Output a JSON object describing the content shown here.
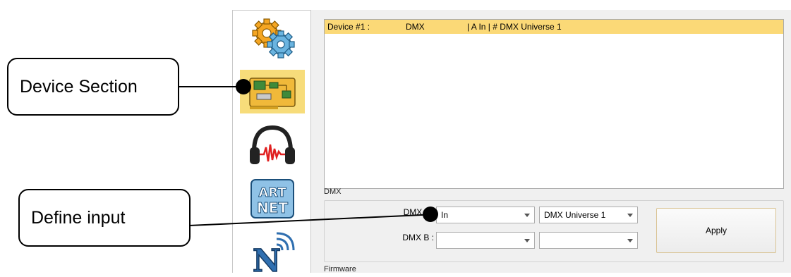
{
  "sidebar": {
    "items": [
      {
        "name": "settings",
        "icon": "gears-icon",
        "active": false
      },
      {
        "name": "device",
        "icon": "circuit-board-icon",
        "active": true
      },
      {
        "name": "audio",
        "icon": "headphones-icon",
        "active": false
      },
      {
        "name": "artnet",
        "icon": "artnet-icon",
        "active": false
      },
      {
        "name": "network",
        "icon": "n-wireless-icon",
        "active": false
      }
    ]
  },
  "device_list": {
    "rows": [
      {
        "device": "Device #1 :",
        "type": "DMX",
        "info": "| A In | # DMX Universe 1",
        "selected": true
      }
    ]
  },
  "dmx": {
    "section_label": "DMX",
    "dmx_a": {
      "label": "DMX A :",
      "mode": "In",
      "universe": "DMX Universe 1"
    },
    "dmx_b": {
      "label": "DMX B :",
      "mode": "",
      "universe": ""
    },
    "apply_label": "Apply"
  },
  "firmware": {
    "section_label": "Firmware"
  },
  "callouts": {
    "device_section": "Device Section",
    "define_input": "Define input"
  },
  "colors": {
    "selection": "#fbd977",
    "active_tab": "#f7dc7a",
    "panel_bg": "#f0f0f0"
  }
}
